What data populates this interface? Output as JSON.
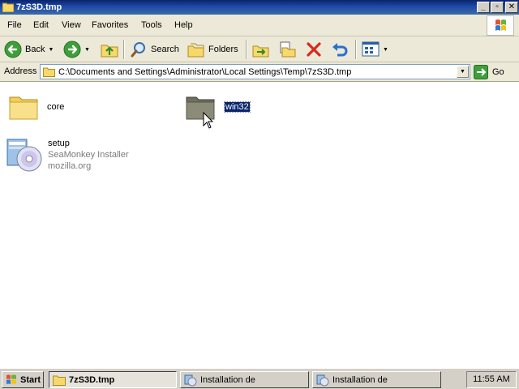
{
  "window": {
    "title": "7zS3D.tmp"
  },
  "menu": [
    "File",
    "Edit",
    "View",
    "Favorites",
    "Tools",
    "Help"
  ],
  "toolbar": {
    "back_label": "Back",
    "search_label": "Search",
    "folders_label": "Folders"
  },
  "address": {
    "label": "Address",
    "path": "C:\\Documents and Settings\\Administrator\\Local Settings\\Temp\\7zS3D.tmp",
    "go_label": "Go"
  },
  "items": [
    {
      "name": "core",
      "type": "folder"
    },
    {
      "name": "win32",
      "type": "folder",
      "selected": true
    },
    {
      "name": "setup",
      "description": "SeaMonkey Installer",
      "company": "mozilla.org",
      "type": "installer"
    }
  ],
  "taskbar": {
    "start_label": "Start",
    "tasks": [
      {
        "label": "7zS3D.tmp",
        "active": true
      },
      {
        "label": "Installation de",
        "active": false
      },
      {
        "label": "Installation de",
        "active": false
      }
    ],
    "clock": "11:55 AM"
  }
}
